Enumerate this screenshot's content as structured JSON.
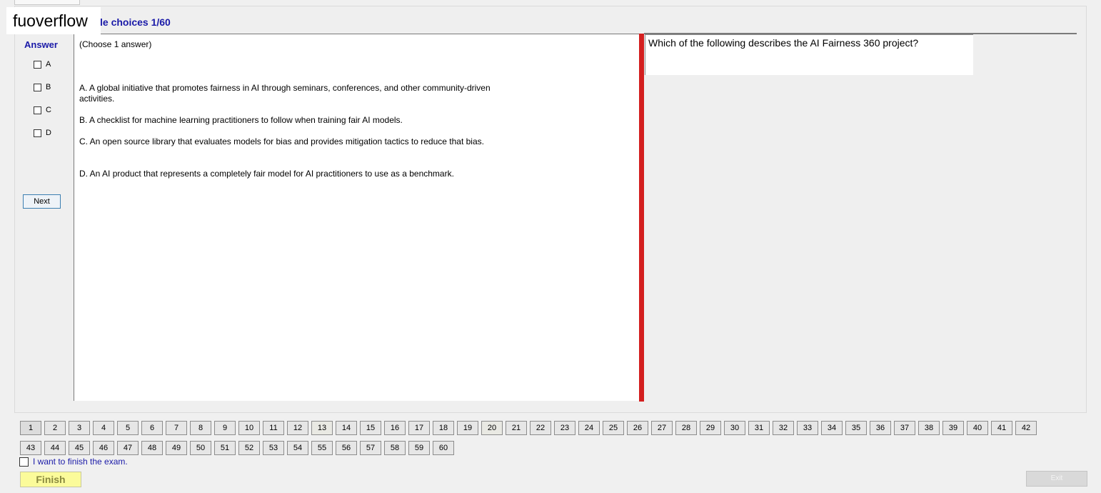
{
  "brand": {
    "label": "fuoverflow"
  },
  "section": {
    "title": "le choices 1/60"
  },
  "answer": {
    "label": "Answer",
    "options": [
      "A",
      "B",
      "C",
      "D"
    ],
    "next_label": "Next"
  },
  "question": {
    "instruction": "(Choose 1 answer)",
    "stem": "Which of the following describes the AI Fairness 360 project?",
    "choices": [
      "A.  A global initiative that promotes fairness in AI through seminars, conferences, and other community-driven activities.",
      "B.  A checklist for machine learning practitioners to follow when training fair AI models.",
      "C.  An open source library that evaluates models for bias and provides mitigation tactics to reduce that bias.",
      "D.  An AI product that represents a completely fair model for AI practitioners to use as a benchmark."
    ]
  },
  "navigation": {
    "question_numbers": [
      "1",
      "2",
      "3",
      "4",
      "5",
      "6",
      "7",
      "8",
      "9",
      "10",
      "11",
      "12",
      "13",
      "14",
      "15",
      "16",
      "17",
      "18",
      "19",
      "20",
      "21",
      "22",
      "23",
      "24",
      "25",
      "26",
      "27",
      "28",
      "29",
      "30",
      "31",
      "32",
      "33",
      "34",
      "35",
      "36",
      "37",
      "38",
      "39",
      "40",
      "41",
      "42",
      "43",
      "44",
      "45",
      "46",
      "47",
      "48",
      "49",
      "50",
      "51",
      "52",
      "53",
      "54",
      "55",
      "56",
      "57",
      "58",
      "59",
      "60"
    ],
    "current": "1"
  },
  "finish": {
    "checkbox_label": "I want to finish the exam.",
    "finish_label": "Finish",
    "exit_label": "Exit"
  },
  "colors": {
    "accent_blue": "#1a1aa8",
    "divider_red": "#d31f1f",
    "finish_yellow": "#fbfb9a"
  }
}
